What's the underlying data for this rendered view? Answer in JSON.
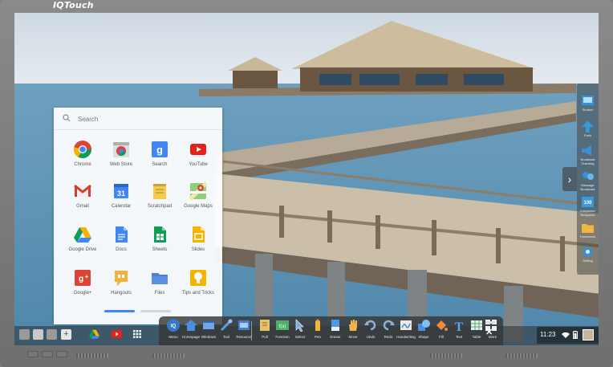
{
  "bezel": {
    "brand": "IQTouch"
  },
  "launcher": {
    "search_placeholder": "Search",
    "apps": [
      {
        "label": "Chrome",
        "icon": "chrome-icon"
      },
      {
        "label": "Web Store",
        "icon": "web-store-icon"
      },
      {
        "label": "Search",
        "icon": "google-search-icon"
      },
      {
        "label": "YouTube",
        "icon": "youtube-icon"
      },
      {
        "label": "Gmail",
        "icon": "gmail-icon"
      },
      {
        "label": "Calendar",
        "icon": "calendar-icon"
      },
      {
        "label": "Scratchpad",
        "icon": "scratchpad-icon"
      },
      {
        "label": "Google Maps",
        "icon": "google-maps-icon"
      },
      {
        "label": "Google Drive",
        "icon": "google-drive-icon"
      },
      {
        "label": "Docs",
        "icon": "docs-icon"
      },
      {
        "label": "Sheets",
        "icon": "sheets-icon"
      },
      {
        "label": "Slides",
        "icon": "slides-icon"
      },
      {
        "label": "Google+",
        "icon": "google-plus-icon"
      },
      {
        "label": "Hangouts",
        "icon": "hangouts-icon"
      },
      {
        "label": "Files",
        "icon": "files-icon"
      },
      {
        "label": "Tips and Tricks",
        "icon": "tips-icon"
      }
    ],
    "calendar_day": "31",
    "active_page": 1,
    "page_count": 2
  },
  "sidebar": {
    "items": [
      {
        "label": "Student",
        "icon": "student-icon"
      },
      {
        "label": "Push",
        "icon": "push-arrow-icon"
      },
      {
        "label": "Broadcast Teaching",
        "icon": "broadcast-icon"
      },
      {
        "label": "Message Broadcast",
        "icon": "message-broadcast-icon"
      },
      {
        "label": "Interactive Response",
        "icon": "interactive-response-icon"
      },
      {
        "label": "Homework",
        "icon": "homework-folder-icon"
      },
      {
        "label": "Setting",
        "icon": "gear-icon"
      }
    ],
    "response_badge": "100",
    "collapse_glyph": "›"
  },
  "toolbar": {
    "items": [
      {
        "label": "Menu",
        "icon": "menu-icon"
      },
      {
        "label": "Homepage",
        "icon": "home-icon"
      },
      {
        "label": "Windows",
        "icon": "windows-icon"
      },
      {
        "label": "Tool",
        "icon": "tool-icon"
      },
      {
        "label": "Resource",
        "icon": "resource-icon"
      },
      {
        "label": "Pull",
        "icon": "pull-icon"
      },
      {
        "label": "Function",
        "icon": "function-icon"
      },
      {
        "label": "Select",
        "icon": "select-cursor-icon"
      },
      {
        "label": "Pen",
        "icon": "pen-icon"
      },
      {
        "label": "Eraser",
        "icon": "eraser-icon"
      },
      {
        "label": "Move",
        "icon": "hand-move-icon"
      },
      {
        "label": "Undo",
        "icon": "undo-icon"
      },
      {
        "label": "Redo",
        "icon": "redo-icon"
      },
      {
        "label": "Handwriting",
        "icon": "handwriting-icon"
      },
      {
        "label": "Shape",
        "icon": "shape-icon"
      },
      {
        "label": "Fill",
        "icon": "fill-icon"
      },
      {
        "label": "Text",
        "icon": "text-icon"
      },
      {
        "label": "Table",
        "icon": "table-icon"
      },
      {
        "label": "More",
        "icon": "more-grid-icon"
      }
    ],
    "menu_badge": "IQ",
    "function_badge": "f(x)",
    "text_glyph": "T",
    "close_glyph": "✕"
  },
  "shelf": {
    "apps": [
      "back-icon",
      "app-icon",
      "forward-icon",
      "add-icon",
      "google-drive-icon",
      "youtube-icon",
      "launcher-grid-icon"
    ]
  },
  "tray": {
    "time": "11:23",
    "icons": [
      "wifi-icon",
      "battery-icon",
      "avatar"
    ]
  },
  "colors": {
    "accent": "#4285f4",
    "toolbar_bg": "#3a3a3a",
    "sidebar_bg": "#4a4a4a"
  }
}
